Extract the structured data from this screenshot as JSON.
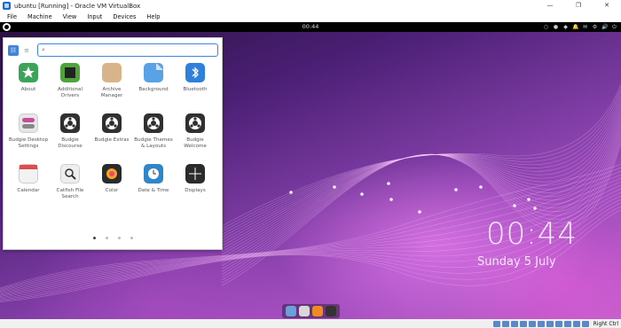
{
  "window": {
    "title": "ubuntu [Running] - Oracle VM VirtualBox",
    "controls": {
      "minimize": "—",
      "restore": "❐",
      "close": "✕"
    }
  },
  "menubar": [
    "File",
    "Machine",
    "View",
    "Input",
    "Devices",
    "Help"
  ],
  "panel": {
    "clock": "00:44",
    "tray": [
      "○",
      "●",
      "◆",
      "🔔",
      "✉",
      "⚙",
      "🔊",
      "⏻"
    ]
  },
  "menu": {
    "search_placeholder": "",
    "search_icon": "⌕",
    "view_grid_icon": "☷",
    "view_list_icon": "≡",
    "apps": [
      {
        "label": "About",
        "icon": "about-icon",
        "color": "#3ba35a"
      },
      {
        "label": "Additional Drivers",
        "icon": "chip-icon",
        "color": "#4fa33a"
      },
      {
        "label": "Archive Manager",
        "icon": "archive-icon",
        "color": "#d9b48a"
      },
      {
        "label": "Background",
        "icon": "background-icon",
        "color": "#5aa2e6"
      },
      {
        "label": "Bluetooth",
        "icon": "bluetooth-icon",
        "color": "#2e80da"
      },
      {
        "label": "Budgie Desktop Settings",
        "icon": "toggle-icon",
        "color": "#e7e7e7"
      },
      {
        "label": "Budgie Discourse",
        "icon": "budgie-icon",
        "color": "#303030"
      },
      {
        "label": "Budgie Extras",
        "icon": "budgie-icon",
        "color": "#303030"
      },
      {
        "label": "Budgie Themes & Layouts",
        "icon": "budgie-icon",
        "color": "#303030"
      },
      {
        "label": "Budgie Welcome",
        "icon": "budgie-icon",
        "color": "#303030"
      },
      {
        "label": "Calendar",
        "icon": "calendar-icon",
        "color": "#f2f2f2"
      },
      {
        "label": "Catfish File Search",
        "icon": "magnifier-icon",
        "color": "#eeeeee"
      },
      {
        "label": "Color",
        "icon": "color-icon",
        "color": "#2b2b2b"
      },
      {
        "label": "Date & Time",
        "icon": "clock-icon",
        "color": "#2f86c9"
      },
      {
        "label": "Displays",
        "icon": "display-icon",
        "color": "#2b2b2b"
      }
    ],
    "page_count": 4,
    "active_page": 1
  },
  "lockclock": {
    "time": "00:44",
    "date": "Sunday  5 July"
  },
  "dock": [
    {
      "icon": "budgie-dock-icon",
      "color": "#6aa0d9"
    },
    {
      "icon": "files-dock-icon",
      "color": "#d8d8d8"
    },
    {
      "icon": "firefox-dock-icon",
      "color": "#f08a24"
    },
    {
      "icon": "terminal-dock-icon",
      "color": "#333333"
    }
  ],
  "statusbar": {
    "host_key": "Right Ctrl"
  }
}
